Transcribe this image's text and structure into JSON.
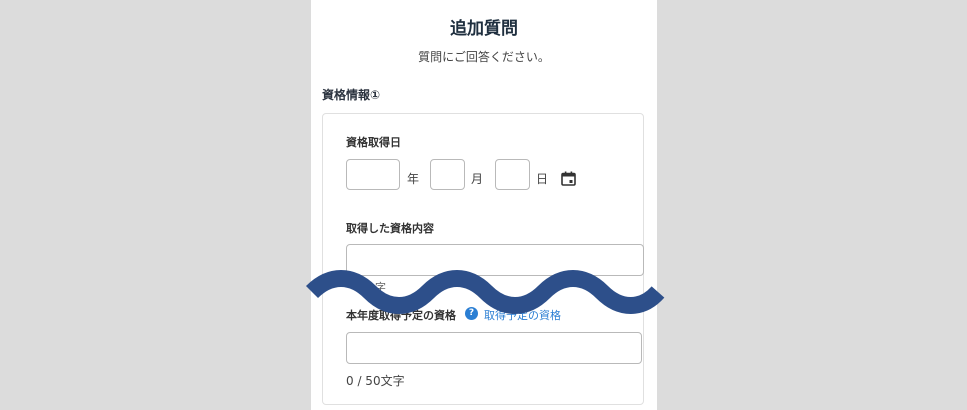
{
  "header": {
    "title": "追加質問",
    "subtitle": "質問にご回答ください。"
  },
  "section": {
    "heading": "資格情報①"
  },
  "fields": {
    "acquisition_date": {
      "label": "資格取得日",
      "year_unit": "年",
      "month_unit": "月",
      "day_unit": "日",
      "calendar_icon": "calendar-icon"
    },
    "acquired_qualification": {
      "label": "取得した資格内容",
      "partial_counter_fragment": "字"
    },
    "planned_qualification": {
      "label": "本年度取得予定の資格",
      "help_icon": "question-circle-icon",
      "help_icon_glyph": "?",
      "help_link_text": "取得予定の資格",
      "char_count": "0 / 50文字"
    }
  },
  "colors": {
    "background": "#dcdcdc",
    "panel": "#ffffff",
    "title_text": "#1f2f3f",
    "link": "#2a7ed3",
    "wave": "#2d4f8a"
  }
}
